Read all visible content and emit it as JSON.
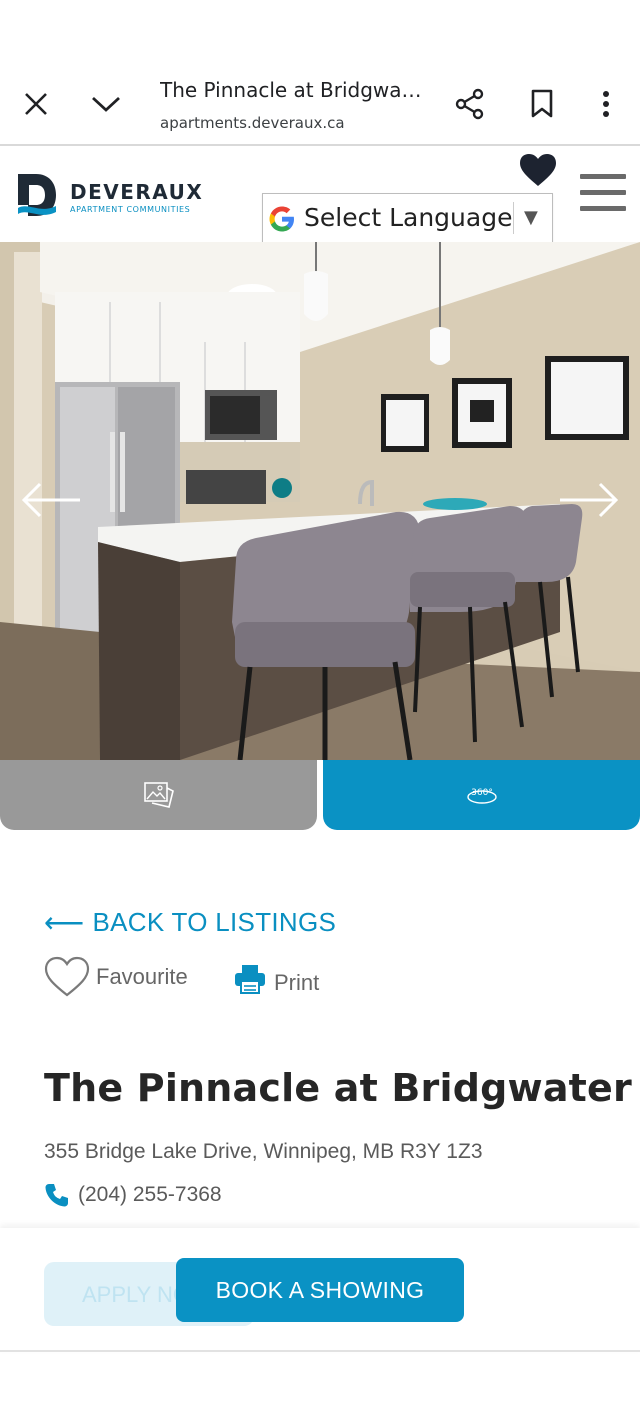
{
  "browser": {
    "title": "The Pinnacle at Bridgwat...",
    "url": "apartments.deveraux.ca",
    "icons": [
      "close-icon",
      "chevron-down-icon",
      "share-icon",
      "bookmark-icon",
      "more-vert-icon"
    ]
  },
  "header": {
    "logo_name": "DEVERAUX",
    "logo_sub": "APARTMENT COMMUNITIES",
    "language_select": "Select Language",
    "language_arrow": "▼"
  },
  "media": {
    "tab_360_label": "360°"
  },
  "content": {
    "back_label": "BACK TO LISTINGS",
    "back_arrow": "⟵",
    "favourite_label": "Favourite",
    "print_label": "Print",
    "title": "The Pinnacle at Bridgwater",
    "address": "355 Bridge Lake Drive, Winnipeg, MB R3Y 1Z3",
    "phone": "(204) 255-7368"
  },
  "bottom_bar": {
    "apply_label": "APPLY NOW",
    "book_label": "BOOK A SHOWING"
  },
  "colors": {
    "accent": "#0a92c4",
    "accent_text": "#0a8fc1",
    "tab_inactive": "#999999",
    "title": "#262626"
  }
}
